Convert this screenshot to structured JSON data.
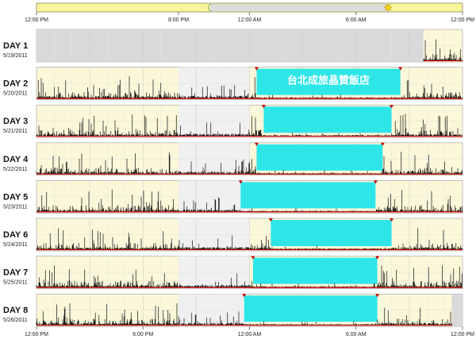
{
  "chart_data": {
    "type": "area",
    "top_axis": {
      "ticks": [
        "12:00 PM",
        "8:00 PM",
        "12:00 AM",
        "6:00 AM",
        "12:00 PM"
      ]
    },
    "bottom_axis": {
      "ticks": [
        "12:00 PM",
        "6:00 PM",
        "12:00 AM",
        "6:00 AM",
        "12:00 PM"
      ]
    },
    "x_range_hours": [
      0,
      24
    ],
    "top_bar": {
      "moon_hour": 9.8,
      "sun_hour": 19.8
    },
    "colors": {
      "day_bg": "#fbf7d9",
      "night_bg": "#f0f0f0",
      "no_data": "#d9d9d9",
      "activity": "#111111",
      "baseline": "#cc0000",
      "sleep": "#2ee6e8"
    },
    "annotation": "台北成旅晶贊飯店",
    "days": [
      {
        "label": "DAY 1",
        "date": "5/19/2011",
        "no_data_until": 21.8,
        "data_from": 21.8,
        "data_to": 24
      },
      {
        "label": "DAY 2",
        "date": "5/20/2011",
        "sleep_start": 12.4,
        "sleep_end": 20.5,
        "data_from": 0,
        "data_to": 24
      },
      {
        "label": "DAY 3",
        "date": "5/21/2011",
        "sleep_start": 12.8,
        "sleep_end": 20.0,
        "data_from": 0,
        "data_to": 24
      },
      {
        "label": "DAY 4",
        "date": "5/22/2011",
        "sleep_start": 12.4,
        "sleep_end": 19.5,
        "data_from": 0,
        "data_to": 24
      },
      {
        "label": "DAY 5",
        "date": "5/23/2011",
        "sleep_start": 11.5,
        "sleep_end": 19.1,
        "data_from": 0,
        "data_to": 24
      },
      {
        "label": "DAY 6",
        "date": "5/24/2011",
        "sleep_start": 13.2,
        "sleep_end": 20.0,
        "data_from": 0,
        "data_to": 24
      },
      {
        "label": "DAY 7",
        "date": "5/25/2011",
        "sleep_start": 12.2,
        "sleep_end": 19.2,
        "data_from": 0,
        "data_to": 24
      },
      {
        "label": "DAY 8",
        "date": "5/26/2011",
        "sleep_start": 11.7,
        "sleep_end": 19.2,
        "data_from": 0,
        "data_to": 23.4
      }
    ]
  }
}
